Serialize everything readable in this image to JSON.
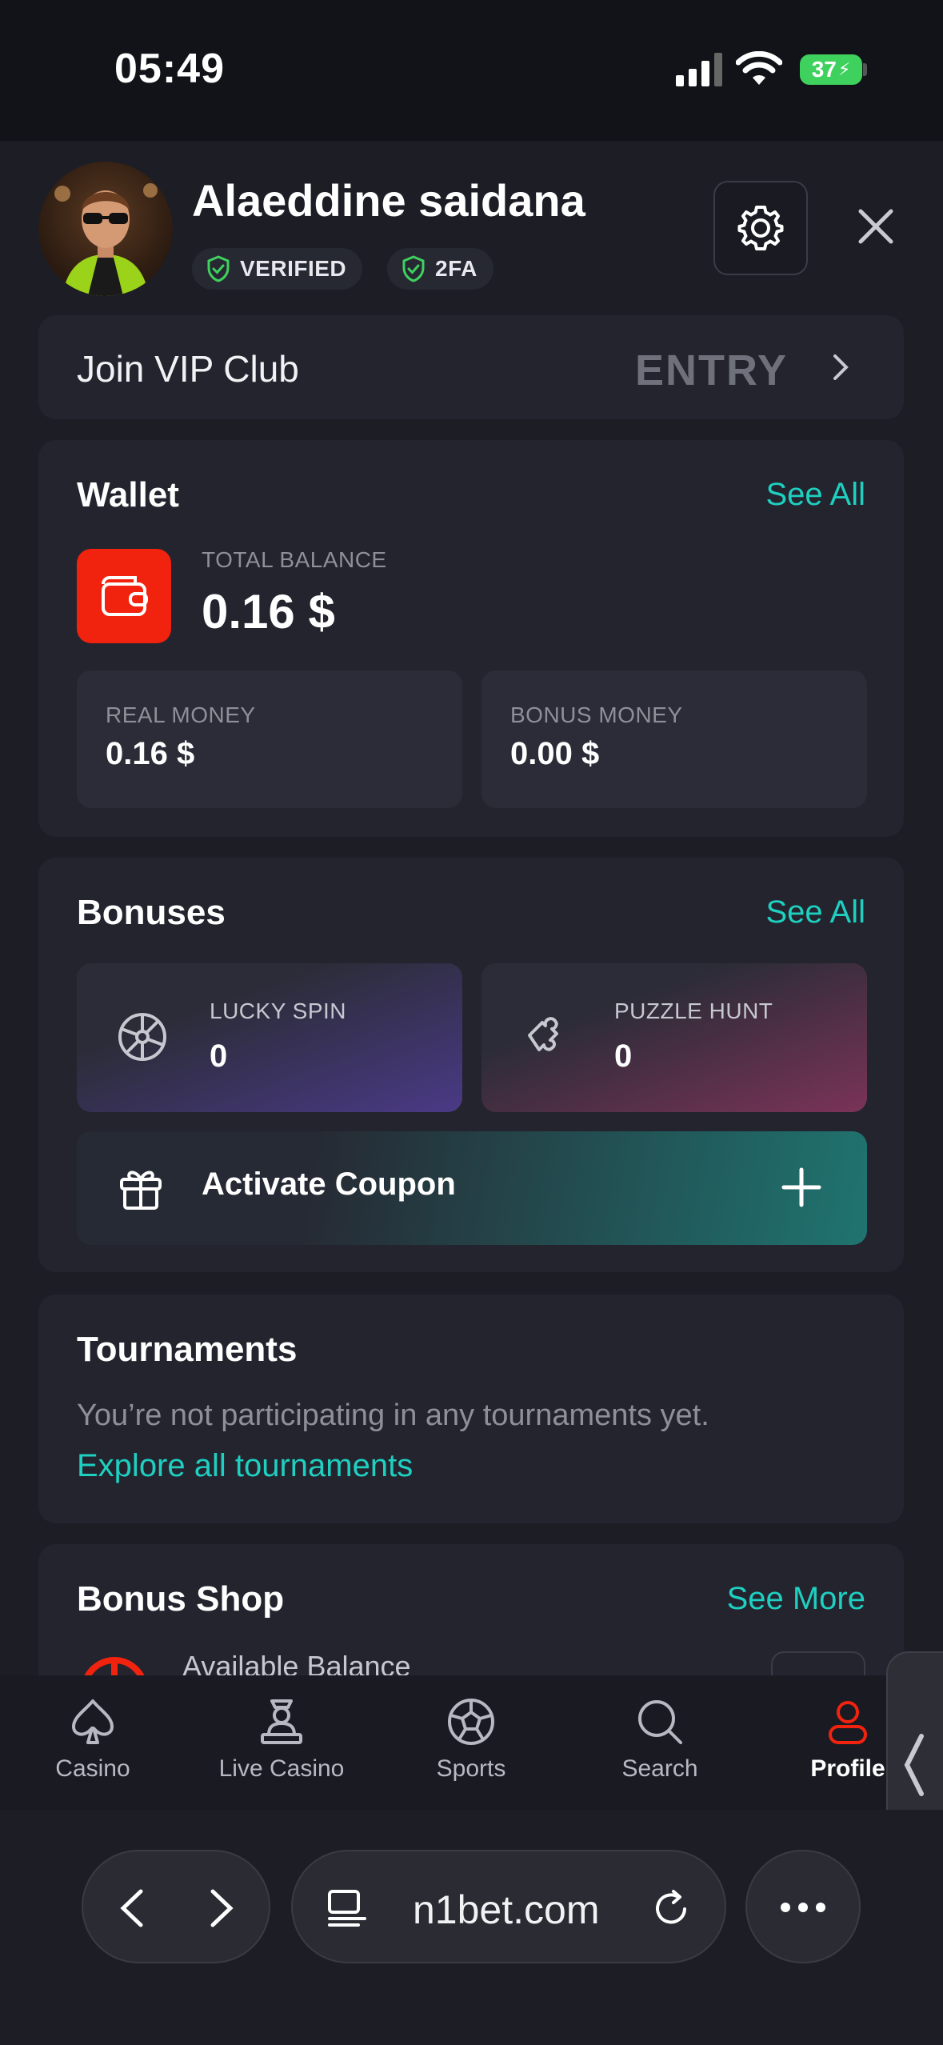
{
  "status_bar": {
    "time": "05:49",
    "battery": "37"
  },
  "profile": {
    "name": "Alaeddine saidana",
    "badges": [
      "VERIFIED",
      "2FA"
    ]
  },
  "vip": {
    "label": "Join VIP Club",
    "level": "ENTRY"
  },
  "wallet": {
    "title": "Wallet",
    "see_all": "See All",
    "total_label": "TOTAL BALANCE",
    "total_value": "0.16 $",
    "real_label": "REAL MONEY",
    "real_value": "0.16 $",
    "bonus_label": "BONUS MONEY",
    "bonus_value": "0.00 $"
  },
  "bonuses": {
    "title": "Bonuses",
    "see_all": "See All",
    "tiles": [
      {
        "label": "LUCKY SPIN",
        "value": "0",
        "icon": "lucky-spin-icon"
      },
      {
        "label": "PUZZLE HUNT",
        "value": "0",
        "icon": "puzzle-icon"
      }
    ],
    "coupon_label": "Activate Coupon"
  },
  "tournaments": {
    "title": "Tournaments",
    "empty_text": "You’re not participating in any tournaments yet.",
    "explore_link": "Explore all tournaments"
  },
  "bonus_shop": {
    "title": "Bonus Shop",
    "see_more": "See More",
    "balance_label": "Available Balance"
  },
  "bottom_nav": [
    {
      "label": "Casino",
      "icon": "spade-icon"
    },
    {
      "label": "Live Casino",
      "icon": "dealer-icon"
    },
    {
      "label": "Sports",
      "icon": "soccer-ball-icon"
    },
    {
      "label": "Search",
      "icon": "search-icon"
    },
    {
      "label": "Profile",
      "icon": "user-icon",
      "active": true
    }
  ],
  "browser": {
    "url": "n1bet.com"
  },
  "colors": {
    "accent": "#1fcfc0",
    "brand_red": "#f2230e",
    "background": "#1c1d25",
    "card": "#23242e"
  }
}
